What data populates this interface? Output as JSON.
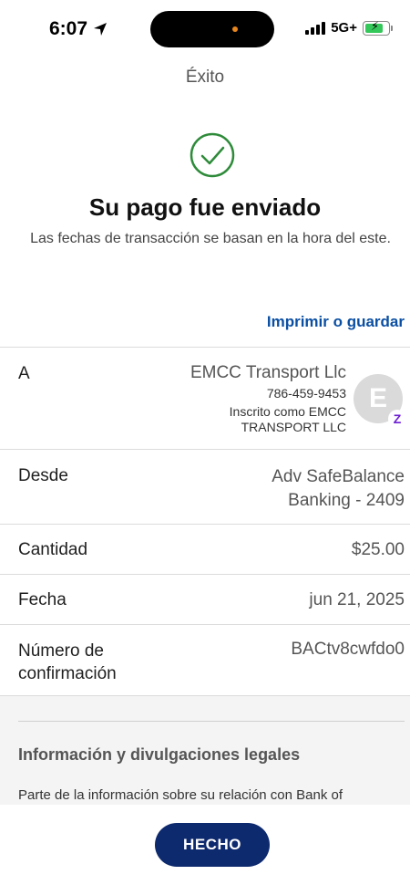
{
  "status_bar": {
    "time": "6:07",
    "network": "5G+",
    "battery_level": 0.8,
    "colors": {
      "battery": "#34c759",
      "island_dot": "#e8871e"
    }
  },
  "header": {
    "title": "Éxito"
  },
  "confirmation": {
    "icon": "check-circle-icon",
    "headline": "Su pago fue enviado",
    "subtitle": "Las fechas de transacción se basan en la hora del este."
  },
  "print_link": "Imprimir o guardar",
  "details": {
    "to": {
      "label": "A",
      "name": "EMCC Transport Llc",
      "phone": "786-459-9453",
      "enrolled": "Inscrito como EMCC TRANSPORT LLC",
      "avatar_initial": "E",
      "badge": "Z"
    },
    "from": {
      "label": "Desde",
      "line1": "Adv SafeBalance",
      "line2": "Banking - 2409"
    },
    "amount": {
      "label": "Cantidad",
      "value": "$25.00"
    },
    "date": {
      "label": "Fecha",
      "value": "jun 21, 2025"
    },
    "confirmation_number": {
      "label_line1": "Número de",
      "label_line2": "confirmación",
      "value": "BACtv8cwfdo0"
    }
  },
  "legal": {
    "title": "Información y divulgaciones legales",
    "text": "Parte de la información sobre su relación con Bank of"
  },
  "footer": {
    "done_label": "HECHO"
  },
  "colors": {
    "link": "#0b4fa3",
    "button": "#0e2a6e",
    "success": "#2e8b3a",
    "zelle": "#6d1ed4"
  }
}
